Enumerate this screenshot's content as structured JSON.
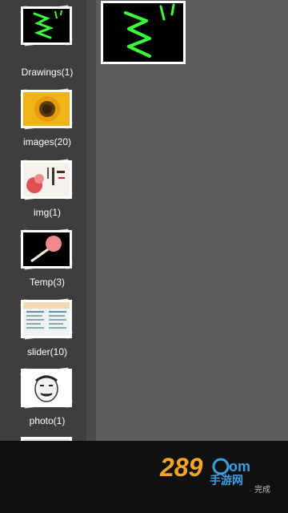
{
  "albums": [
    {
      "label": "Drawings(1)",
      "icon": "drawing-thumbnail"
    },
    {
      "label": "images(20)",
      "icon": "sunflower-thumbnail"
    },
    {
      "label": "img(1)",
      "icon": "calligraphy-thumbnail"
    },
    {
      "label": "Temp(3)",
      "icon": "lollipop-thumbnail"
    },
    {
      "label": "slider(10)",
      "icon": "document-thumbnail"
    },
    {
      "label": "photo(1)",
      "icon": "meme-face-thumbnail"
    }
  ],
  "main": {
    "thumb_icon": "drawing-thumbnail"
  },
  "watermark": {
    "logo_text": "289.com",
    "sub_text": "手游网"
  },
  "bottom": {
    "done_label": "完成"
  },
  "colors": {
    "sidebar_bg": "#3e3e3e",
    "main_bg": "#5b5b5b",
    "bottom_bg": "#101010",
    "stroke_green": "#39ff3c",
    "logo_orange": "#f5a623",
    "logo_blue": "#3aa0e0"
  }
}
